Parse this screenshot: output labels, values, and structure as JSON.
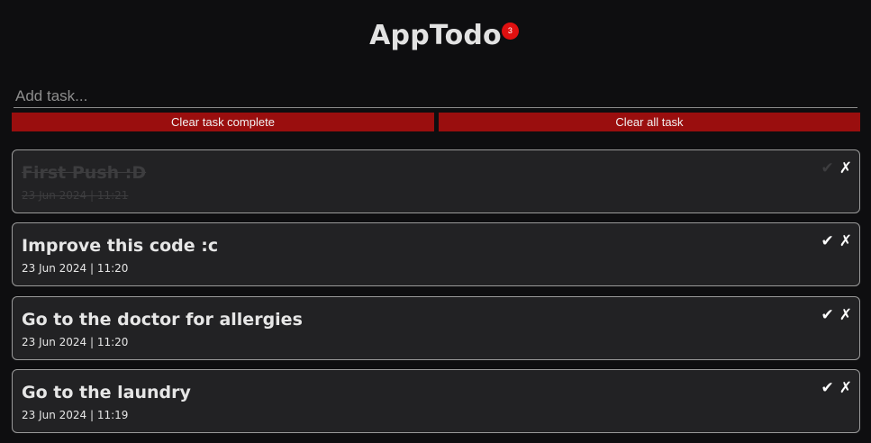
{
  "app": {
    "title": "AppTodo",
    "badge_count": "3"
  },
  "input": {
    "placeholder": "Add task..."
  },
  "buttons": {
    "clear_complete": "Clear task complete",
    "clear_all": "Clear all task"
  },
  "tasks": [
    {
      "title": "First Push :D",
      "date": "23 Jun 2024 | 11:21",
      "completed": true
    },
    {
      "title": "Improve this code :c",
      "date": "23 Jun 2024 | 11:20",
      "completed": false
    },
    {
      "title": "Go to the doctor for allergies",
      "date": "23 Jun 2024 | 11:20",
      "completed": false
    },
    {
      "title": "Go to the laundry",
      "date": "23 Jun 2024 | 11:19",
      "completed": false
    }
  ],
  "icons": {
    "complete": "✔",
    "delete": "✗"
  },
  "colors": {
    "accent": "#9a0e0e",
    "badge": "#e01010",
    "card_bg": "#222224",
    "page_bg": "#0e0e10"
  }
}
